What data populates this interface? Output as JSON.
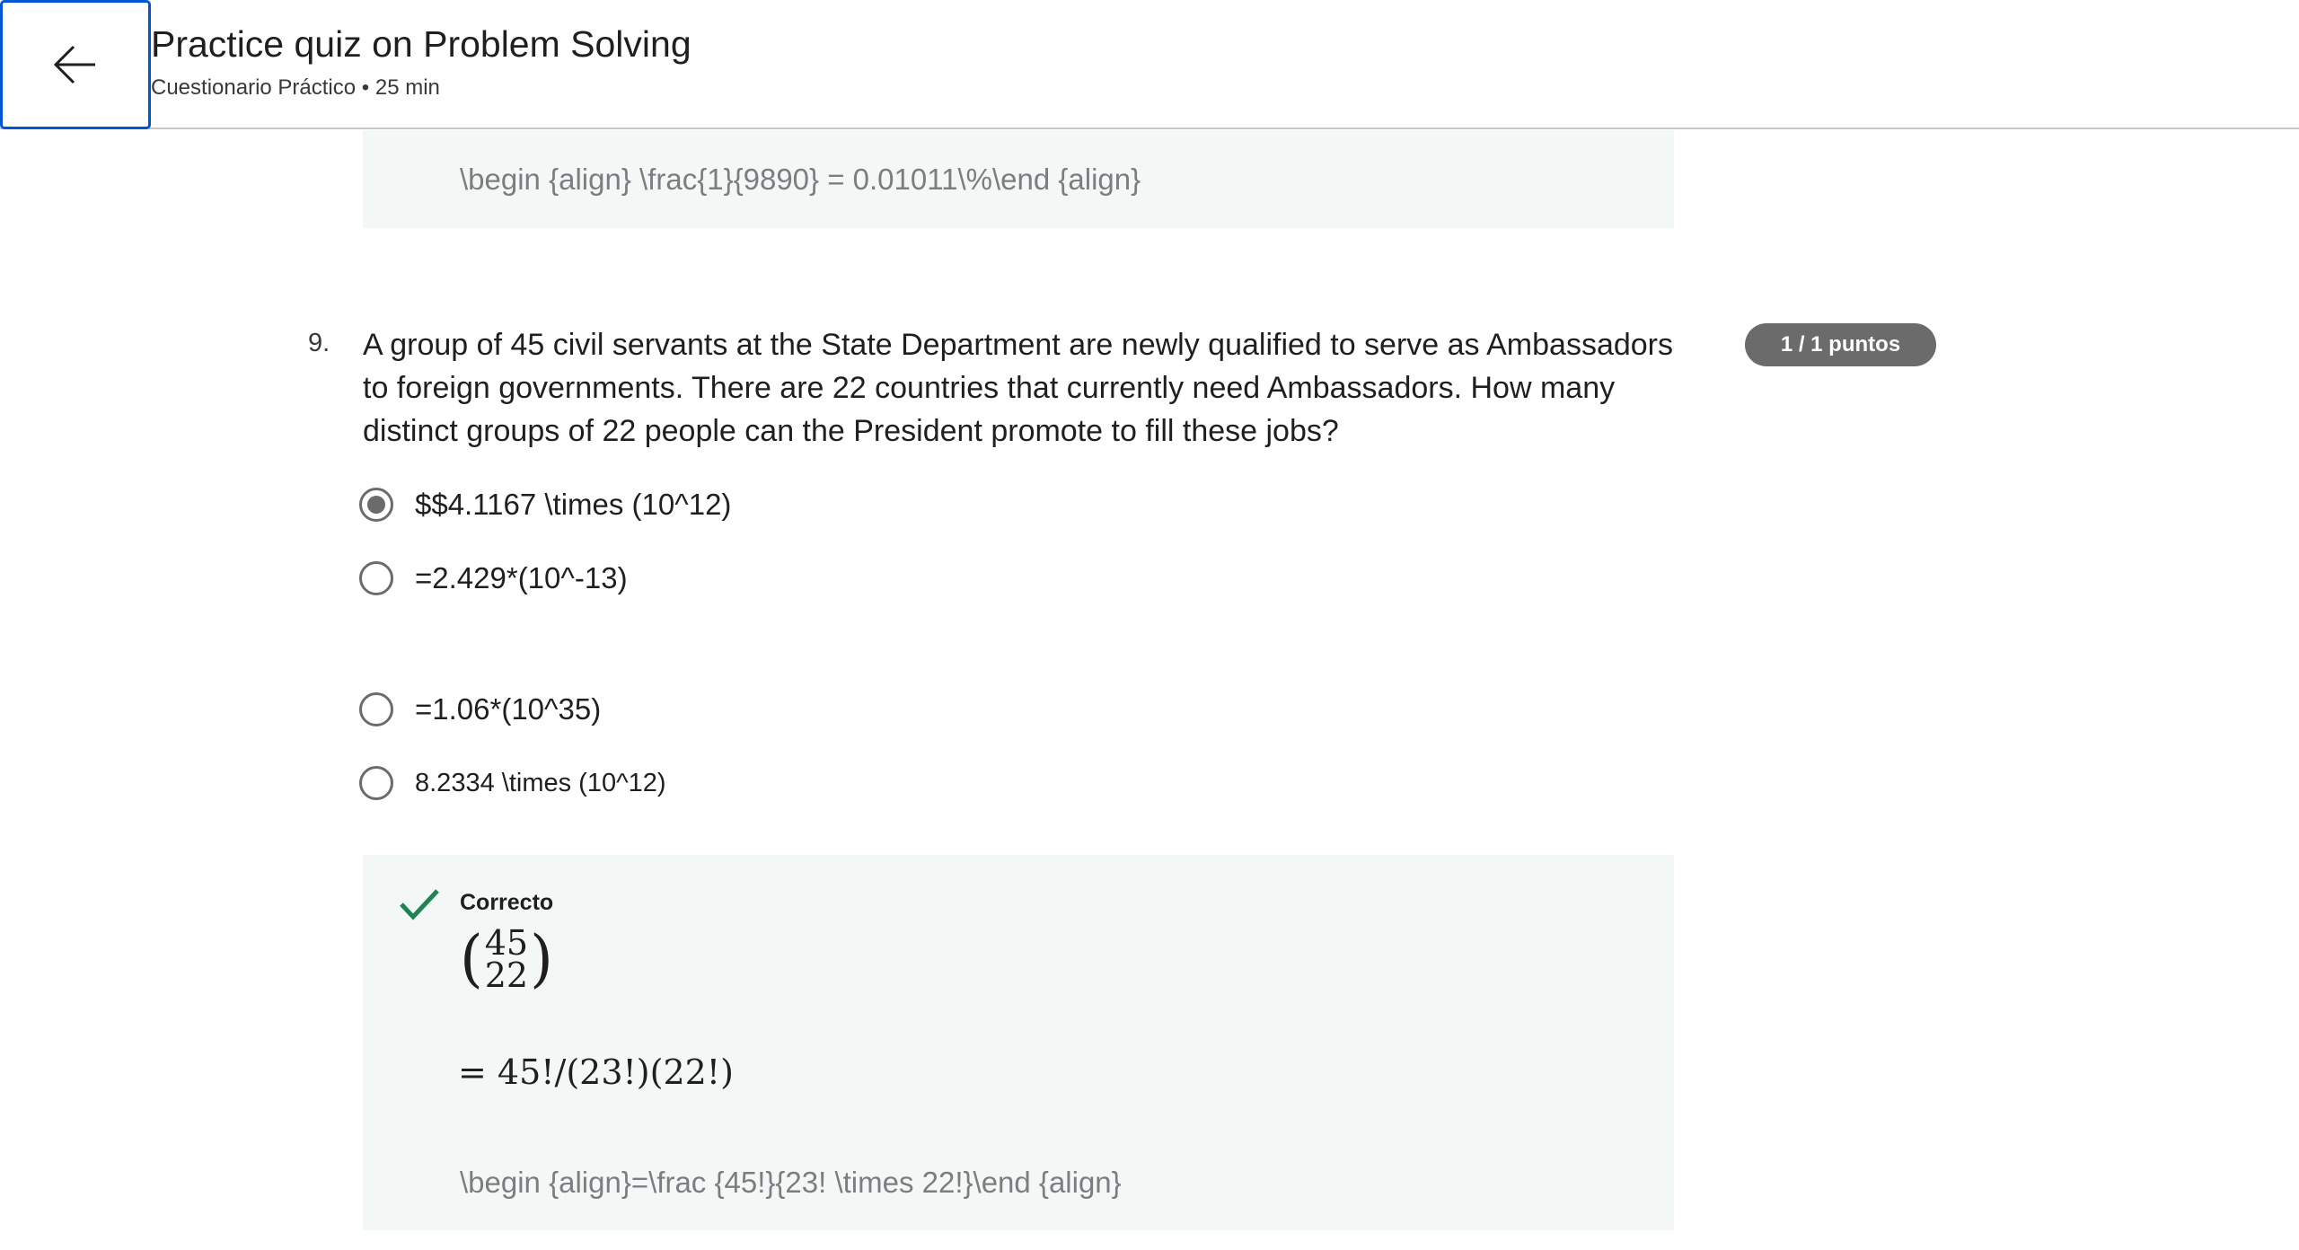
{
  "header": {
    "title": "Practice quiz on Problem Solving",
    "subtitle": "Cuestionario Práctico • 25 min",
    "back_icon": "arrow-left-icon"
  },
  "previous_feedback": {
    "text": "\\begin {align} \\frac{1}{9890} = 0.01011\\%\\end {align}"
  },
  "question": {
    "number": "9.",
    "text": "A group of 45 civil servants at the State Department are newly qualified to serve as Ambassadors to foreign governments. There are 22 countries that currently need Ambassadors. How many distinct groups of 22 people can the President promote to fill these jobs?",
    "points": "1 / 1 puntos",
    "options": [
      {
        "label": "$$4.1167 \\times (10^12)",
        "selected": true
      },
      {
        "label": "=2.429*(10^-13)",
        "selected": false
      },
      {
        "label": "=1.06*(10^35)",
        "selected": false
      },
      {
        "label": "8.2334 \\times (10^12)",
        "selected": false
      }
    ]
  },
  "feedback": {
    "status": "Correcto",
    "status_icon": "checkmark-icon",
    "binom_top": "45",
    "binom_bottom": "22",
    "formula": "= 45!/(23!)(22!)",
    "raw_text": "\\begin {align}=\\frac {45!}{23! \\times 22!}\\end {align}"
  },
  "colors": {
    "accent": "#0056d2",
    "badge": "#6b6b6b",
    "feedback_bg": "#f3f8f6",
    "correct_green": "#1f8354"
  }
}
